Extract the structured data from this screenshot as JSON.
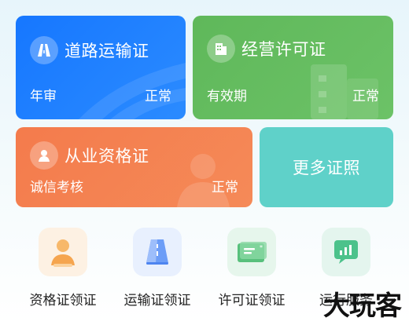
{
  "cards": {
    "road": {
      "title": "道路运输证",
      "sub": "年审",
      "status": "正常"
    },
    "biz": {
      "title": "经营许可证",
      "sub": "有效期",
      "status": "正常"
    },
    "qual": {
      "title": "从业资格证",
      "sub": "诚信考核",
      "status": "正常"
    },
    "more": {
      "label": "更多证照"
    }
  },
  "tools": [
    {
      "label": "资格证领证",
      "icon": "person-certificate-icon"
    },
    {
      "label": "运输证领证",
      "icon": "road-certificate-icon"
    },
    {
      "label": "许可证领证",
      "icon": "license-card-icon"
    },
    {
      "label": "运行服务",
      "icon": "chart-service-icon"
    }
  ],
  "watermark": "大玩客",
  "colors": {
    "road": "#1677ff",
    "biz": "#5fb85a",
    "qual": "#f47b4c",
    "more": "#5fd1c9"
  }
}
